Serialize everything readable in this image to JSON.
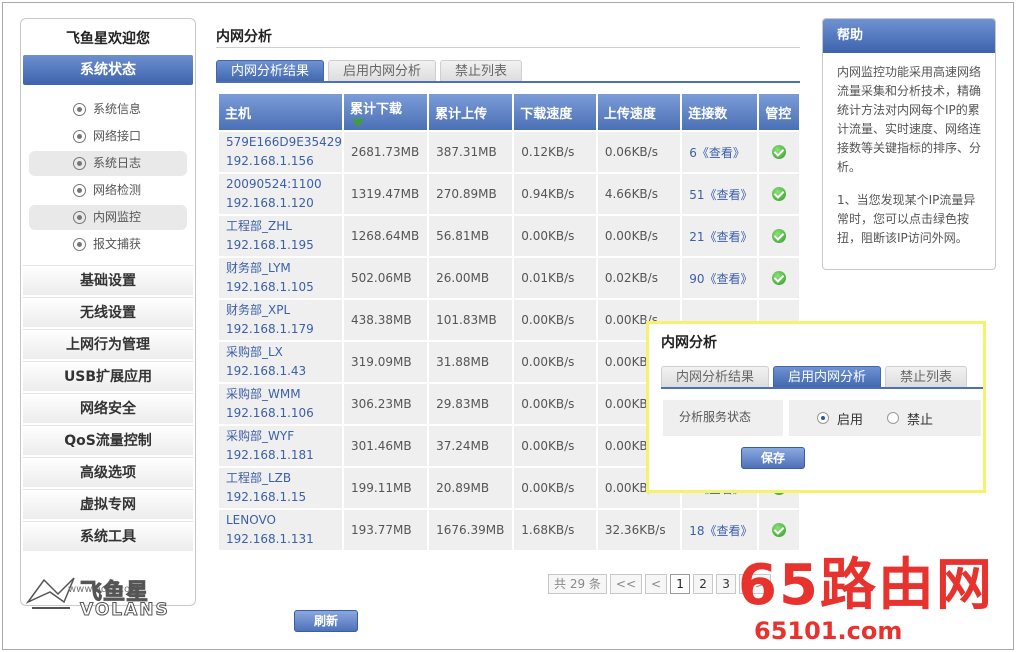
{
  "sidebar": {
    "welcome": "飞鱼星欢迎您",
    "status_header": "系统状态",
    "sub_items": [
      {
        "label": "系统信息"
      },
      {
        "label": "网络接口"
      },
      {
        "label": "系统日志"
      },
      {
        "label": "网络检测"
      },
      {
        "label": "内网监控"
      },
      {
        "label": "报文捕获"
      }
    ],
    "menu": [
      {
        "label": "基础设置"
      },
      {
        "label": "无线设置"
      },
      {
        "label": "上网行为管理"
      },
      {
        "label": "USB扩展应用"
      },
      {
        "label": "网络安全"
      },
      {
        "label": "QoS流量控制"
      },
      {
        "label": "高级选项"
      },
      {
        "label": "虚拟专网"
      },
      {
        "label": "系统工具"
      }
    ],
    "logo": {
      "cn": "飞鱼星",
      "en": "VOLANS",
      "url": "www.adsl.com"
    }
  },
  "main": {
    "title": "内网分析",
    "tabs": [
      {
        "label": "内网分析结果"
      },
      {
        "label": "启用内网分析"
      },
      {
        "label": "禁止列表"
      }
    ],
    "columns": [
      {
        "label": "主机"
      },
      {
        "label": "累计下载"
      },
      {
        "label": "累计上传"
      },
      {
        "label": "下载速度"
      },
      {
        "label": "上传速度"
      },
      {
        "label": "连接数"
      },
      {
        "label": "管控"
      }
    ],
    "rows": [
      {
        "name": "579E166D9E35429",
        "ip": "192.168.1.156",
        "down": "2681.73MB",
        "up": "387.31MB",
        "dspeed": "0.12KB/s",
        "uspeed": "0.06KB/s",
        "conn": "6《查看》"
      },
      {
        "name": "20090524:1100",
        "ip": "192.168.1.120",
        "down": "1319.47MB",
        "up": "270.89MB",
        "dspeed": "0.94KB/s",
        "uspeed": "4.66KB/s",
        "conn": "51《查看》"
      },
      {
        "name": "工程部_ZHL",
        "ip": "192.168.1.195",
        "down": "1268.64MB",
        "up": "56.81MB",
        "dspeed": "0.00KB/s",
        "uspeed": "0.00KB/s",
        "conn": "21《查看》"
      },
      {
        "name": "财务部_LYM",
        "ip": "192.168.1.105",
        "down": "502.06MB",
        "up": "26.00MB",
        "dspeed": "0.01KB/s",
        "uspeed": "0.02KB/s",
        "conn": "90《查看》"
      },
      {
        "name": "财务部_XPL",
        "ip": "192.168.1.179",
        "down": "438.38MB",
        "up": "101.83MB",
        "dspeed": "0.00KB/s",
        "uspeed": "0.00KB/s",
        "conn": ""
      },
      {
        "name": "采购部_LX",
        "ip": "192.168.1.43",
        "down": "319.09MB",
        "up": "31.88MB",
        "dspeed": "0.00KB/s",
        "uspeed": "0.00KB/s",
        "conn": ""
      },
      {
        "name": "采购部_WMM",
        "ip": "192.168.1.106",
        "down": "306.23MB",
        "up": "29.83MB",
        "dspeed": "0.00KB/s",
        "uspeed": "0.00KB/s",
        "conn": ""
      },
      {
        "name": "采购部_WYF",
        "ip": "192.168.1.181",
        "down": "301.46MB",
        "up": "37.24MB",
        "dspeed": "0.00KB/s",
        "uspeed": "0.00KB/s",
        "conn": ""
      },
      {
        "name": "工程部_LZB",
        "ip": "192.168.1.15",
        "down": "199.11MB",
        "up": "20.89MB",
        "dspeed": "0.00KB/s",
        "uspeed": "0.00KB/s",
        "conn": "0《查看》"
      },
      {
        "name": "LENOVO",
        "ip": "192.168.1.131",
        "down": "193.77MB",
        "up": "1676.39MB",
        "dspeed": "1.68KB/s",
        "uspeed": "32.36KB/s",
        "conn": "18《查看》"
      }
    ],
    "pager": {
      "total": "共 29 条",
      "first": "<<",
      "prev": "<",
      "pages": [
        "1",
        "2",
        "3"
      ],
      "next": ">>"
    },
    "refresh_label": "刷新"
  },
  "help": {
    "title": "帮助",
    "paragraphs": [
      "内网监控功能采用高速网络流量采集和分析技术，精确统计方法对内网每个IP的累计流量、实时速度、网络连接数等关键指标的排序、分析。",
      "1、当您发现某个IP流量异常时，您可以点击绿色按扭，阻断该IP访问外网。"
    ]
  },
  "popup": {
    "title": "内网分析",
    "tabs": [
      {
        "label": "内网分析结果"
      },
      {
        "label": "启用内网分析"
      },
      {
        "label": "禁止列表"
      }
    ],
    "service_label": "分析服务状态",
    "option_on": "启用",
    "option_off": "禁止",
    "save_label": "保存"
  },
  "watermark": {
    "big": "65路由网",
    "url": "65101.com"
  },
  "colors": {
    "accent": "#4c70b4",
    "ok": "#3ea12c",
    "highlight": "#f6f26b",
    "watermark": "#e8322e"
  }
}
